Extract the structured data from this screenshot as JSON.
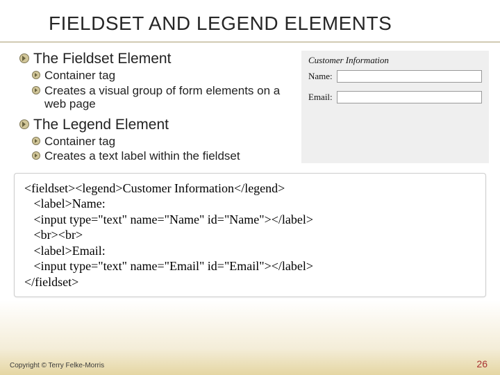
{
  "title": "FIELDSET AND LEGEND ELEMENTS",
  "sections": [
    {
      "heading": "The Fieldset Element",
      "items": [
        "Container tag",
        "Creates a visual group of form elements on a web page"
      ]
    },
    {
      "heading": "The Legend Element",
      "items": [
        "Container tag",
        "Creates a text label within the fieldset"
      ]
    }
  ],
  "example": {
    "legend": "Customer Information",
    "fields": [
      {
        "label": "Name:"
      },
      {
        "label": "Email:"
      }
    ]
  },
  "code": "<fieldset><legend>Customer Information</legend>\n   <label>Name:\n   <input type=\"text\" name=\"Name\" id=\"Name\"></label>\n   <br><br>\n   <label>Email:\n   <input type=\"text\" name=\"Email\" id=\"Email\"></label>\n</fieldset>",
  "footer": "Copyright © Terry Felke-Morris",
  "page": "26"
}
